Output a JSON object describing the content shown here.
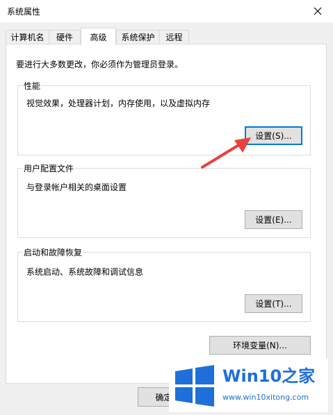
{
  "window": {
    "title": "系统属性"
  },
  "tabs": [
    {
      "label": "计算机名"
    },
    {
      "label": "硬件"
    },
    {
      "label": "高级"
    },
    {
      "label": "系统保护"
    },
    {
      "label": "远程"
    }
  ],
  "notice": "要进行大多数更改，你必须作为管理员登录。",
  "groups": {
    "performance": {
      "title": "性能",
      "desc": "视觉效果，处理器计划，内存使用，以及虚拟内存",
      "button": "设置(S)..."
    },
    "profile": {
      "title": "用户配置文件",
      "desc": "与登录帐户相关的桌面设置",
      "button": "设置(E)..."
    },
    "startup": {
      "title": "启动和故障恢复",
      "desc": "系统启动、系统故障和调试信息",
      "button": "设置(T)..."
    }
  },
  "env_button": "环境变量(N)...",
  "ok_button": "确定",
  "watermark": {
    "title": "Win10之家",
    "url": "www.win10xitong.com"
  },
  "colors": {
    "accent": "#0078d7",
    "arrow": "#e8413c",
    "logo": "#1e6fd9"
  }
}
